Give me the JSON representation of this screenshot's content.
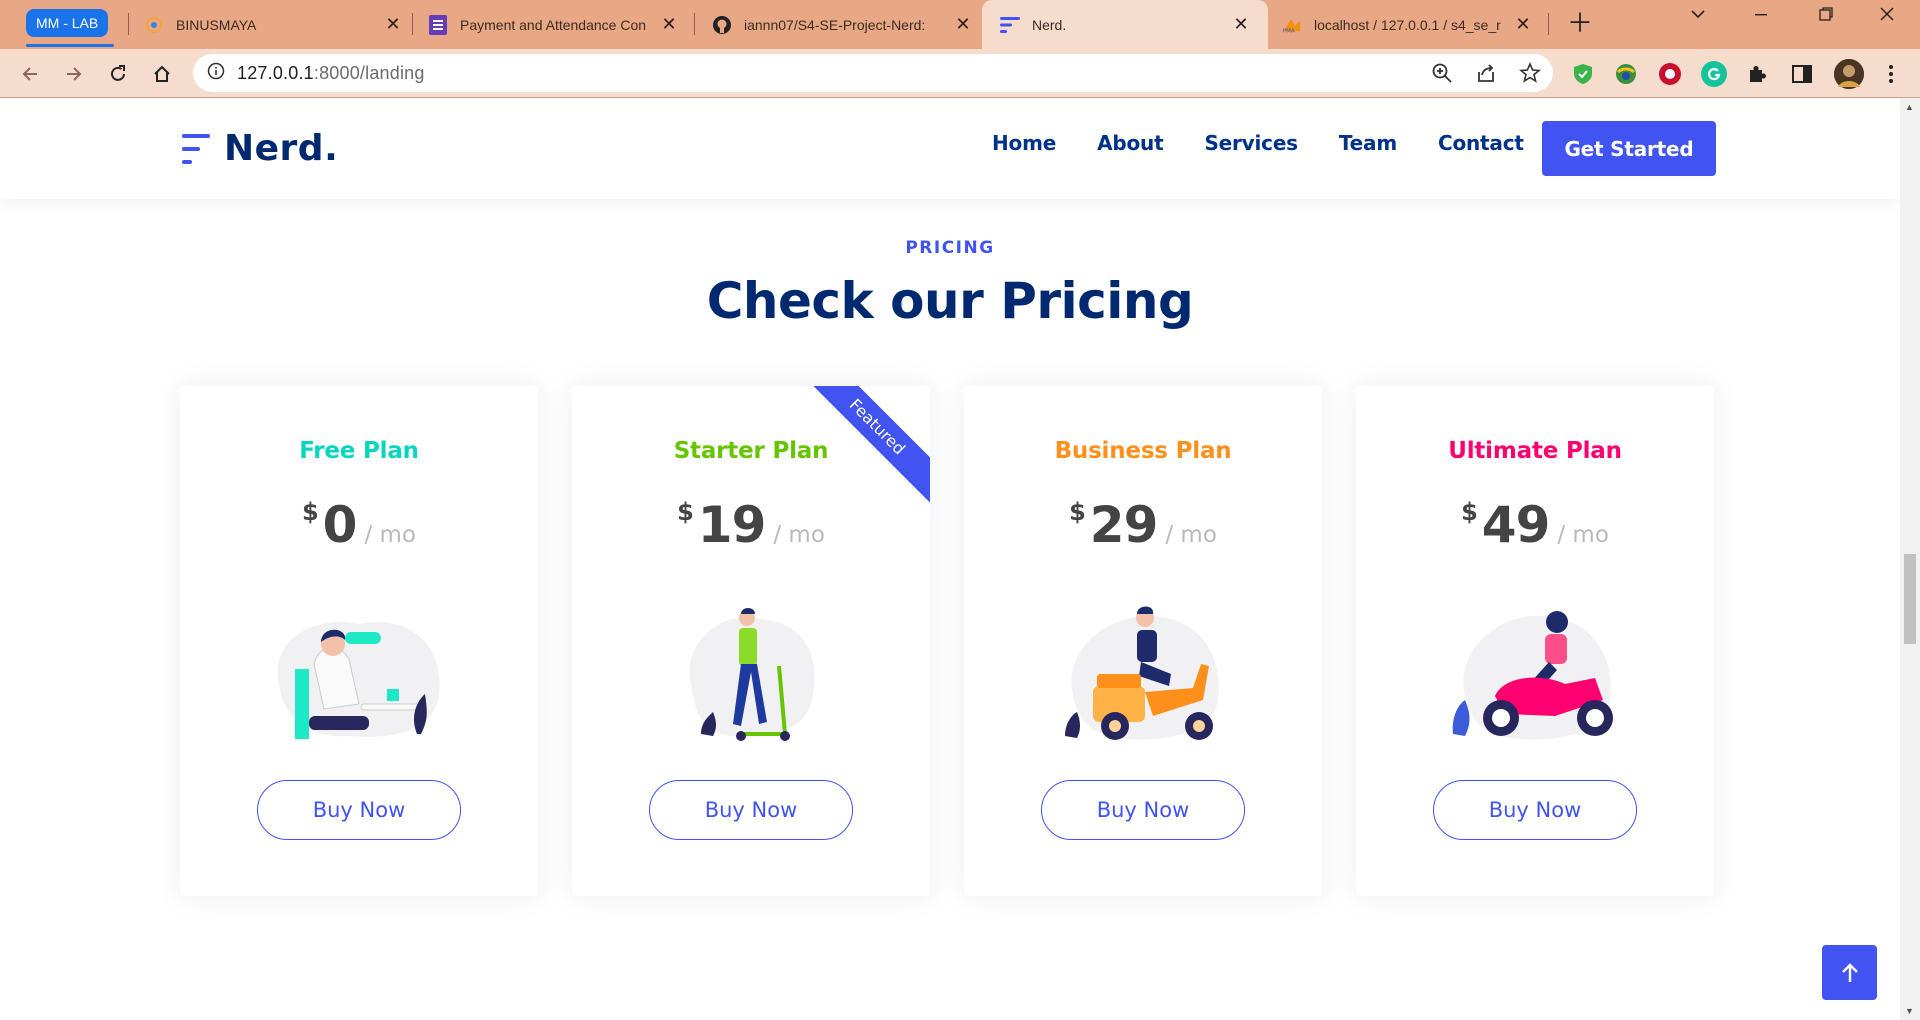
{
  "browser": {
    "tab_group": "MM - LAB",
    "tabs": [
      {
        "title": "BINUSMAYA",
        "icon": "binusmaya-icon"
      },
      {
        "title": "Payment and Attendance Con",
        "icon": "forms-icon"
      },
      {
        "title": "iannn07/S4-SE-Project-Nerd:",
        "icon": "github-icon"
      },
      {
        "title": "Nerd.",
        "icon": "nerd-favicon",
        "active": true
      },
      {
        "title": "localhost / 127.0.0.1 / s4_se_r",
        "icon": "phpmyadmin-icon"
      }
    ],
    "url_host": "127.0.0.1",
    "url_rest": ":8000/landing"
  },
  "site": {
    "brand": "Nerd.",
    "nav": [
      "Home",
      "About",
      "Services",
      "Team",
      "Contact"
    ],
    "cta": "Get Started"
  },
  "pricing": {
    "eyebrow": "PRICING",
    "title": "Check our Pricing",
    "currency": "$",
    "period": "/ mo",
    "buy_label": "Buy Now",
    "featured_label": "Featured",
    "plans": [
      {
        "name": "Free Plan",
        "price": "0",
        "color": "#07d5c0"
      },
      {
        "name": "Starter Plan",
        "price": "19",
        "color": "#65c600",
        "featured": true
      },
      {
        "name": "Business Plan",
        "price": "29",
        "color": "#ff901c"
      },
      {
        "name": "Ultimate Plan",
        "price": "49",
        "color": "#ff0071"
      }
    ]
  },
  "colors": {
    "accent": "#4154f1",
    "heading": "#012970",
    "tabbar": "#e9a885"
  }
}
